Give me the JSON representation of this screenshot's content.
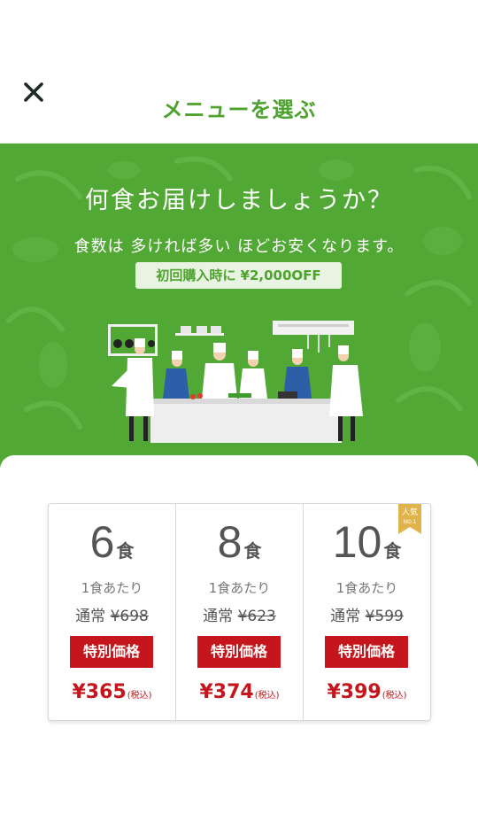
{
  "header": {
    "title": "メニューを選ぶ",
    "close_icon": "close-icon"
  },
  "hero": {
    "title": "何食お届けしましょうか？",
    "subtitle": "食数は 多ければ多い ほどお安くなります。",
    "promo": "初回購入時に ¥2,000OFF",
    "bg_color": "#52a835",
    "illustration": "chefs-kitchen-illustration"
  },
  "plans": [
    {
      "count": "6",
      "unit": "食",
      "per_meal": "1食あたり",
      "regular_label": "通常",
      "regular_price": "¥698",
      "special_label": "特別価格",
      "price": "¥365",
      "tax": "(税込)"
    },
    {
      "count": "8",
      "unit": "食",
      "per_meal": "1食あたり",
      "regular_label": "通常",
      "regular_price": "¥623",
      "special_label": "特別価格",
      "price": "¥374",
      "tax": "(税込)"
    },
    {
      "count": "10",
      "unit": "食",
      "per_meal": "1食あたり",
      "regular_label": "通常",
      "regular_price": "¥599",
      "special_label": "特別価格",
      "price": "¥399",
      "tax": "(税込)",
      "badge_line1": "人気",
      "badge_line2": "NO.1"
    }
  ],
  "colors": {
    "accent_green": "#4ea32f",
    "price_red": "#c4161c",
    "badge_gold": "#e0b44a"
  }
}
